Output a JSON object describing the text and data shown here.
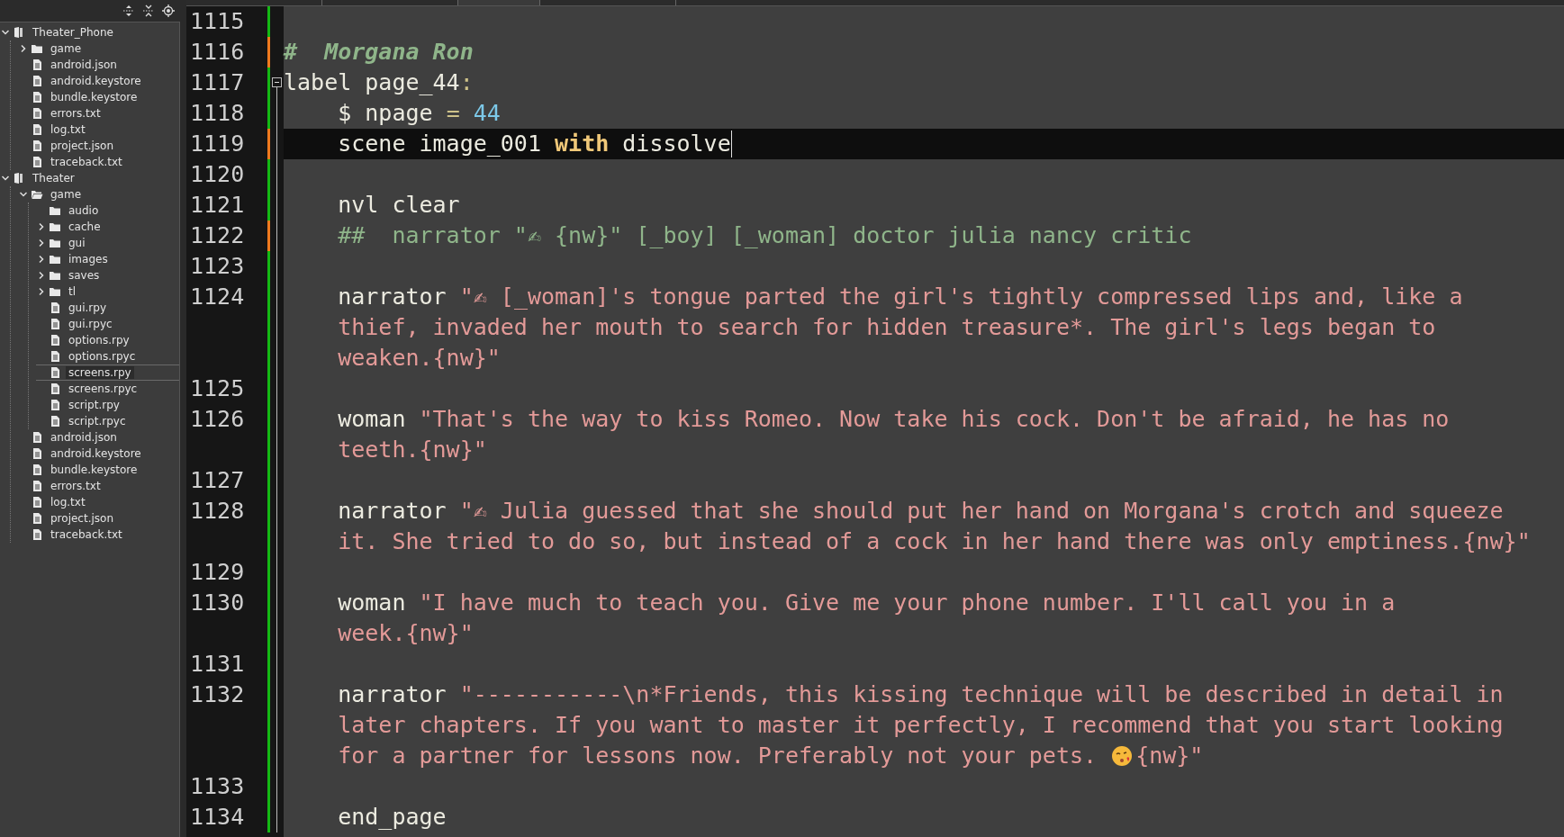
{
  "sidebar": {
    "toolbar": [
      {
        "kind": "collapse"
      },
      {
        "kind": "expand"
      },
      {
        "kind": "locate"
      }
    ],
    "tree": [
      {
        "label": "Theater_Phone",
        "kind": "project",
        "expanded": true,
        "selected": false,
        "children": [
          {
            "label": "game",
            "kind": "folder",
            "expanded": false,
            "selected": false
          },
          {
            "label": "android.json",
            "kind": "file",
            "selected": false
          },
          {
            "label": "android.keystore",
            "kind": "file",
            "selected": false
          },
          {
            "label": "bundle.keystore",
            "kind": "file",
            "selected": false
          },
          {
            "label": "errors.txt",
            "kind": "file",
            "selected": false
          },
          {
            "label": "log.txt",
            "kind": "file",
            "selected": false
          },
          {
            "label": "project.json",
            "kind": "file",
            "selected": false
          },
          {
            "label": "traceback.txt",
            "kind": "file",
            "selected": false
          }
        ]
      },
      {
        "label": "Theater",
        "kind": "project",
        "expanded": true,
        "selected": false,
        "children": [
          {
            "label": "game",
            "kind": "folder",
            "expanded": true,
            "selected": false,
            "children": [
              {
                "label": "audio",
                "kind": "folder",
                "selected": false
              },
              {
                "label": "cache",
                "kind": "folder",
                "expanded": false,
                "selected": false
              },
              {
                "label": "gui",
                "kind": "folder",
                "expanded": false,
                "selected": false
              },
              {
                "label": "images",
                "kind": "folder",
                "expanded": false,
                "selected": false
              },
              {
                "label": "saves",
                "kind": "folder",
                "expanded": false,
                "selected": false
              },
              {
                "label": "tl",
                "kind": "folder",
                "expanded": false,
                "selected": false
              },
              {
                "label": "gui.rpy",
                "kind": "file",
                "selected": false
              },
              {
                "label": "gui.rpyc",
                "kind": "file",
                "selected": false
              },
              {
                "label": "options.rpy",
                "kind": "file",
                "selected": false
              },
              {
                "label": "options.rpyc",
                "kind": "file",
                "selected": false
              },
              {
                "label": "screens.rpy",
                "kind": "file",
                "selected": true
              },
              {
                "label": "screens.rpyc",
                "kind": "file",
                "selected": false
              },
              {
                "label": "script.rpy",
                "kind": "file",
                "selected": false
              },
              {
                "label": "script.rpyc",
                "kind": "file",
                "selected": false
              }
            ]
          },
          {
            "label": "android.json",
            "kind": "file",
            "selected": false
          },
          {
            "label": "android.keystore",
            "kind": "file",
            "selected": false
          },
          {
            "label": "bundle.keystore",
            "kind": "file",
            "selected": false
          },
          {
            "label": "errors.txt",
            "kind": "file",
            "selected": false
          },
          {
            "label": "log.txt",
            "kind": "file",
            "selected": false
          },
          {
            "label": "project.json",
            "kind": "file",
            "selected": false
          },
          {
            "label": "traceback.txt",
            "kind": "file",
            "selected": false
          }
        ]
      }
    ]
  },
  "editor": {
    "lines": [
      {
        "number": "1115",
        "modified": false,
        "rows": [
          []
        ]
      },
      {
        "number": "1116",
        "modified": true,
        "rows": [
          [
            {
              "kind": "heading",
              "text": "#  Morgana Ron"
            }
          ]
        ]
      },
      {
        "number": "1117",
        "modified": false,
        "folded": false,
        "rows": [
          [
            {
              "kind": "plain",
              "text": "label page_44"
            },
            {
              "kind": "operator",
              "text": ":"
            }
          ]
        ]
      },
      {
        "number": "1118",
        "modified": false,
        "rows": [
          [
            {
              "kind": "plain",
              "text": "    $ npage "
            },
            {
              "kind": "operator",
              "text": "="
            },
            {
              "kind": "number",
              "text": " 44"
            }
          ]
        ]
      },
      {
        "number": "1119",
        "modified": true,
        "current": true,
        "cursor": true,
        "rows": [
          [
            {
              "kind": "plain",
              "text": "    scene image_001 "
            },
            {
              "kind": "keyword",
              "text": "with"
            },
            {
              "kind": "plain",
              "text": " dissolve"
            }
          ]
        ]
      },
      {
        "number": "1120",
        "modified": false,
        "rows": [
          []
        ]
      },
      {
        "number": "1121",
        "modified": false,
        "rows": [
          [
            {
              "kind": "plain",
              "text": "    nvl clear"
            }
          ]
        ]
      },
      {
        "number": "1122",
        "modified": true,
        "rows": [
          [
            {
              "kind": "comment",
              "text": "    ##  narrator \"✍ {nw}\" [_boy] [_woman] doctor julia nancy critic"
            }
          ]
        ]
      },
      {
        "number": "1123",
        "modified": false,
        "rows": [
          []
        ]
      },
      {
        "number": "1124",
        "modified": false,
        "rows": [
          [
            {
              "kind": "plain",
              "text": "    narrator "
            },
            {
              "kind": "string",
              "text": "\"✍ [_woman]'s tongue parted the girl's tightly compressed lips and, like a"
            }
          ],
          [
            {
              "kind": "string",
              "text": "    thief, invaded her mouth to search for hidden treasure*. The girl's legs began to"
            }
          ],
          [
            {
              "kind": "string",
              "text": "    weaken.{nw}\""
            }
          ]
        ]
      },
      {
        "number": "1125",
        "modified": false,
        "rows": [
          []
        ]
      },
      {
        "number": "1126",
        "modified": false,
        "rows": [
          [
            {
              "kind": "plain",
              "text": "    woman "
            },
            {
              "kind": "string",
              "text": "\"That's the way to kiss Romeo. Now take his cock. Don't be afraid, he has no"
            }
          ],
          [
            {
              "kind": "string",
              "text": "    teeth.{nw}\""
            }
          ]
        ]
      },
      {
        "number": "1127",
        "modified": false,
        "rows": [
          []
        ]
      },
      {
        "number": "1128",
        "modified": false,
        "rows": [
          [
            {
              "kind": "plain",
              "text": "    narrator "
            },
            {
              "kind": "string",
              "text": "\"✍ Julia guessed that she should put her hand on Morgana's crotch and squeeze"
            }
          ],
          [
            {
              "kind": "string",
              "text": "    it. She tried to do so, but instead of a cock in her hand there was only emptiness.{nw}\""
            }
          ]
        ]
      },
      {
        "number": "1129",
        "modified": false,
        "rows": [
          []
        ]
      },
      {
        "number": "1130",
        "modified": false,
        "rows": [
          [
            {
              "kind": "plain",
              "text": "    woman "
            },
            {
              "kind": "string",
              "text": "\"I have much to teach you. Give me your phone number. I'll call you in a"
            }
          ],
          [
            {
              "kind": "string",
              "text": "    week.{nw}\""
            }
          ]
        ]
      },
      {
        "number": "1131",
        "modified": false,
        "rows": [
          []
        ]
      },
      {
        "number": "1132",
        "modified": false,
        "rows": [
          [
            {
              "kind": "plain",
              "text": "    narrator "
            },
            {
              "kind": "string",
              "text": "\"-----------\\n*Friends, this kissing technique will be described in detail in"
            }
          ],
          [
            {
              "kind": "string",
              "text": "    later chapters. If you want to master it perfectly, I recommend that you start looking"
            }
          ],
          [
            {
              "kind": "string",
              "text": "    for a partner for lessons now. Preferably not your pets. "
            },
            {
              "kind": "emoji"
            },
            {
              "kind": "string",
              "text": "{nw}\""
            }
          ]
        ]
      },
      {
        "number": "1133",
        "modified": false,
        "rows": [
          []
        ]
      },
      {
        "number": "1134",
        "modified": false,
        "rows": [
          [
            {
              "kind": "plain",
              "text": "    end_page"
            }
          ]
        ]
      }
    ]
  }
}
